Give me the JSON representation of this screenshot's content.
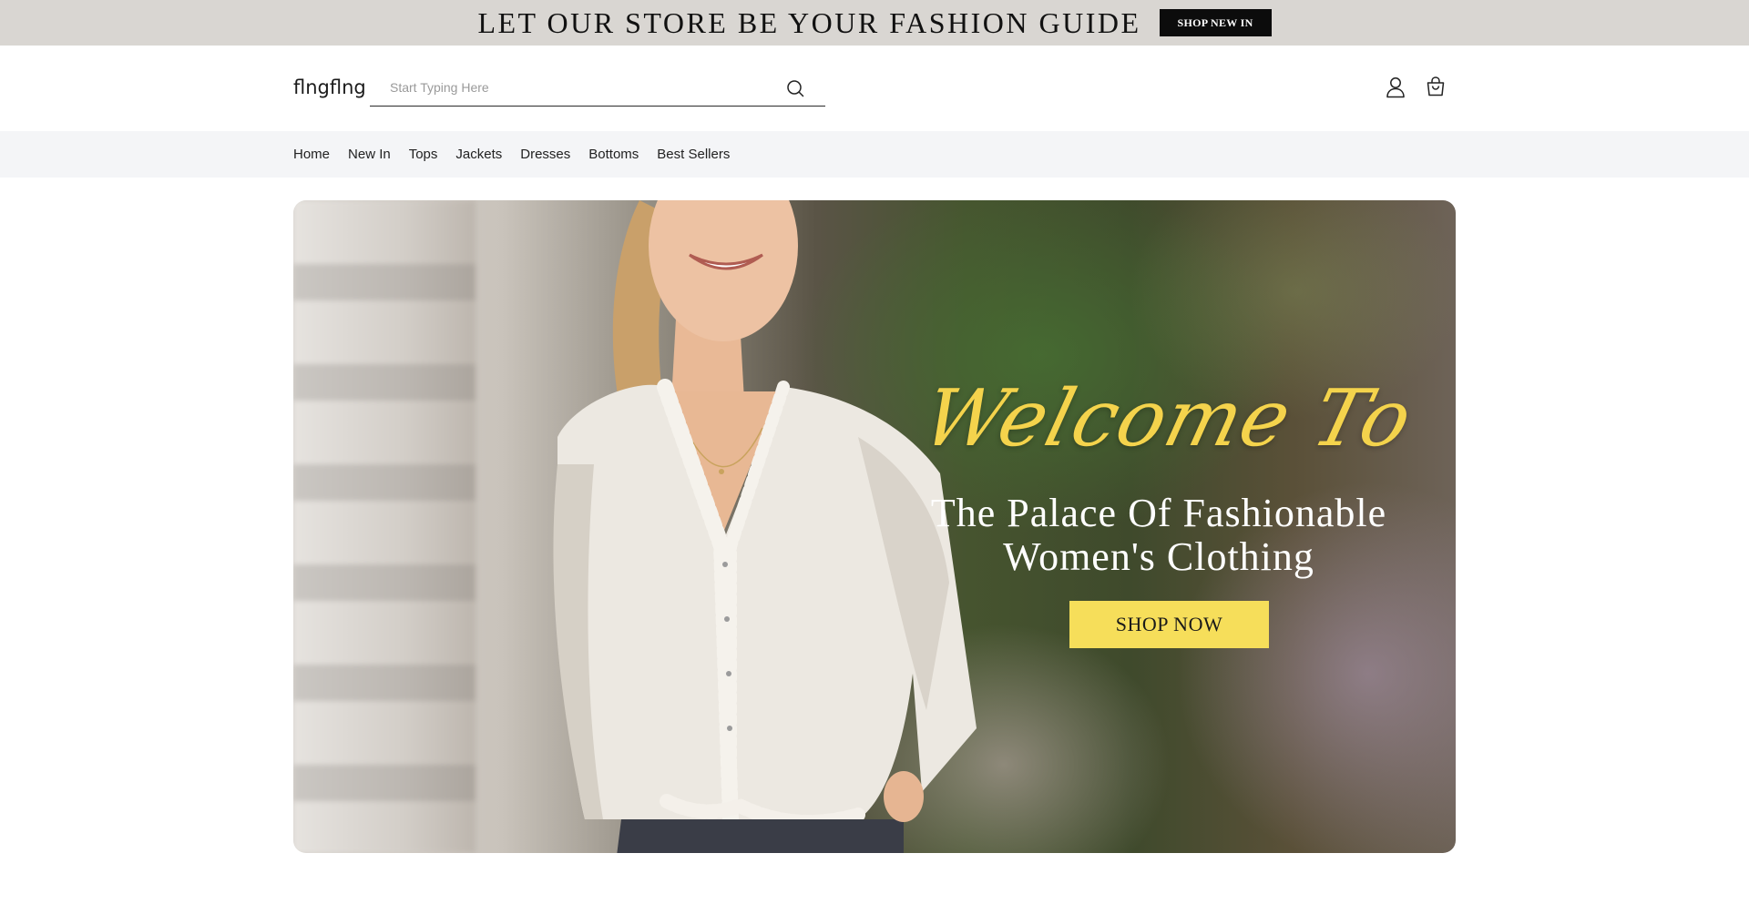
{
  "announcement": {
    "text": "LET OUR STORE BE YOUR FASHION GUIDE",
    "button_label": "SHOP NEW IN"
  },
  "header": {
    "logo": "flngflng",
    "search": {
      "placeholder": "Start Typing Here",
      "value": ""
    },
    "icons": [
      "search-icon",
      "user-icon",
      "shopping-bag-icon"
    ]
  },
  "nav": {
    "items": [
      {
        "label": "Home"
      },
      {
        "label": "New In"
      },
      {
        "label": "Tops"
      },
      {
        "label": "Jackets"
      },
      {
        "label": "Dresses"
      },
      {
        "label": "Bottoms"
      },
      {
        "label": "Best Sellers"
      }
    ]
  },
  "hero": {
    "script_heading": "Welcome To",
    "title_line1": "The Palace Of Fashionable",
    "title_line2": "Women's Clothing",
    "button_label": "SHOP NOW",
    "accent_color": "#f6de5a"
  }
}
